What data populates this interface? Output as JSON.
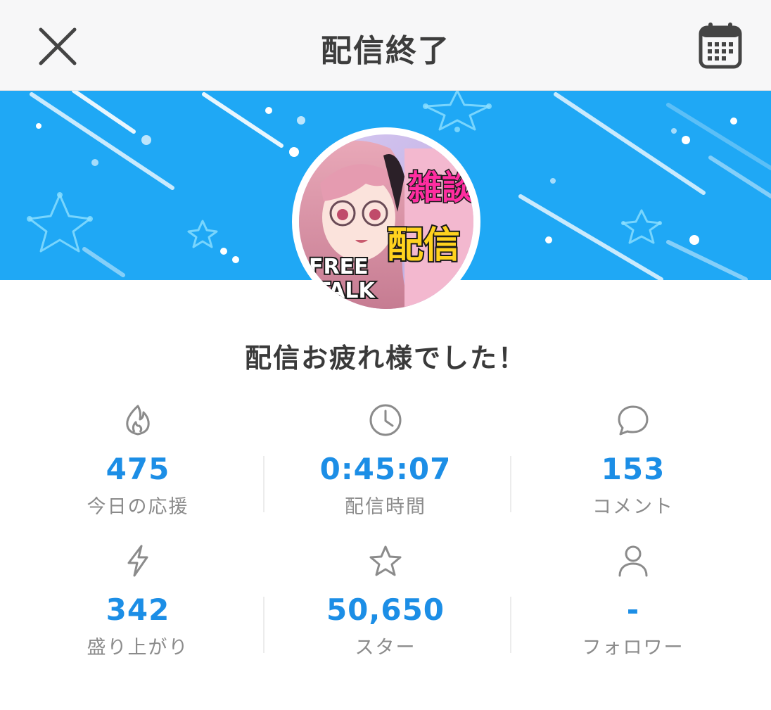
{
  "header": {
    "title": "配信終了",
    "close_icon": "close-icon",
    "calendar_icon": "calendar-icon"
  },
  "banner": {
    "background_color": "#1fa8f5",
    "avatar_texts": [
      "FREE",
      "TALK",
      "雑談",
      "配信"
    ]
  },
  "main": {
    "thanks_message": "配信お疲れ様でした！"
  },
  "stats": [
    {
      "icon": "flame-icon",
      "value": "475",
      "label": "今日の応援"
    },
    {
      "icon": "clock-icon",
      "value": "0:45:07",
      "label": "配信時間"
    },
    {
      "icon": "speech-bubble-icon",
      "value": "153",
      "label": "コメント"
    },
    {
      "icon": "lightning-icon",
      "value": "342",
      "label": "盛り上がり"
    },
    {
      "icon": "star-icon",
      "value": "50,650",
      "label": "スター"
    },
    {
      "icon": "person-icon",
      "value": "-",
      "label": "フォロワー"
    }
  ],
  "colors": {
    "accent": "#1c8ee6",
    "label": "#8b8b8b",
    "banner": "#1fa8f5"
  }
}
